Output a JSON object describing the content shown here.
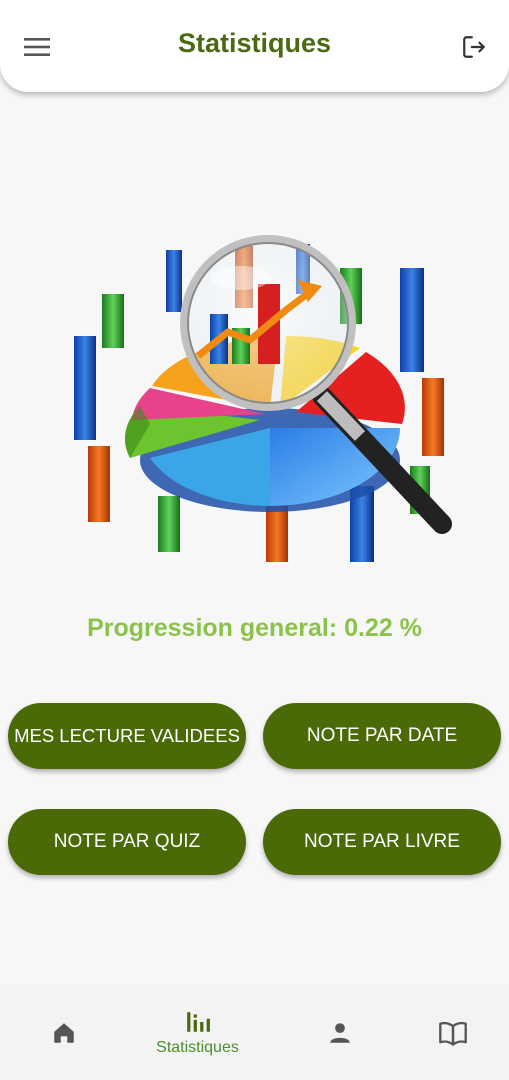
{
  "header": {
    "title": "Statistiques",
    "menu_icon": "menu-icon",
    "logout_icon": "logout-icon"
  },
  "illustration": {
    "description_icon": "statistics-magnifier-illustration"
  },
  "progress": {
    "label": "Progression general: 0.22 %",
    "value_percent": 0.22
  },
  "actions": {
    "validated_readings": "MES LECTURE VALIDEES",
    "grade_by_date": "NOTE PAR DATE",
    "grade_by_quiz": "NOTE PAR QUIZ",
    "grade_by_book": "NOTE PAR LIVRE"
  },
  "bottom_nav": {
    "items": [
      {
        "icon": "home-icon",
        "label": ""
      },
      {
        "icon": "bar-chart-icon",
        "label": "Statistiques",
        "active": true
      },
      {
        "icon": "person-icon",
        "label": ""
      },
      {
        "icon": "book-icon",
        "label": ""
      }
    ]
  },
  "colors": {
    "primary": "#4a6a08",
    "title": "#4a6a12",
    "progress_text": "#8bc34a",
    "active_nav": "#4e8f2f",
    "inactive_nav": "#555555"
  }
}
